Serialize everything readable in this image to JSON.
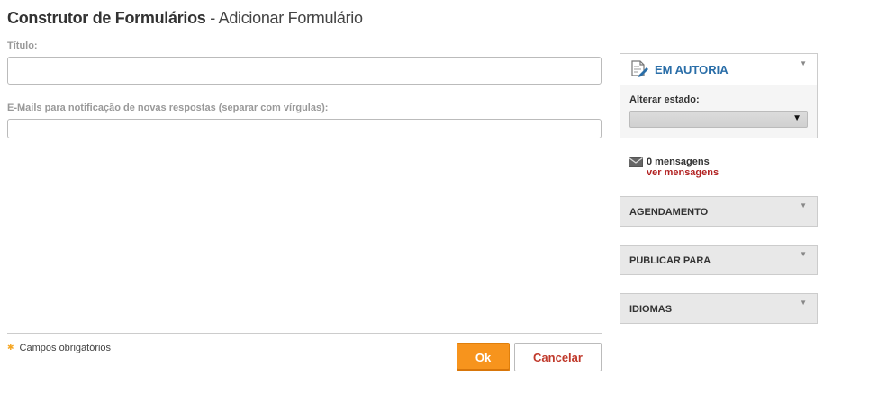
{
  "header": {
    "title_strong": "Construtor de Formulários",
    "title_rest": " - Adicionar Formulário"
  },
  "form": {
    "title_label": "Título:",
    "title_value": "",
    "emails_label": "E-Mails para notificação de novas respostas (separar com vírgulas):",
    "emails_value": "",
    "required_note": "Campos obrigatórios",
    "ok_label": "Ok",
    "cancel_label": "Cancelar"
  },
  "sidebar": {
    "status": {
      "title": "EM AUTORIA",
      "change_label": "Alterar estado:",
      "selected": ""
    },
    "messages": {
      "count_text": "0 mensagens",
      "link_text": "ver mensagens"
    },
    "panels": {
      "scheduling": "AGENDAMENTO",
      "publish_to": "PUBLICAR PARA",
      "languages": "IDIOMAS"
    }
  },
  "icons": {
    "status": "document-edit-icon",
    "messages": "envelope-icon",
    "collapse": "collapse-arrow-icon",
    "select": "dropdown-caret-icon",
    "required": "required-star-icon"
  },
  "colors": {
    "primary_button": "#f7941d",
    "status_title": "#2a6ea8",
    "link": "#b22222",
    "panel_bg": "#e8e8e8"
  }
}
